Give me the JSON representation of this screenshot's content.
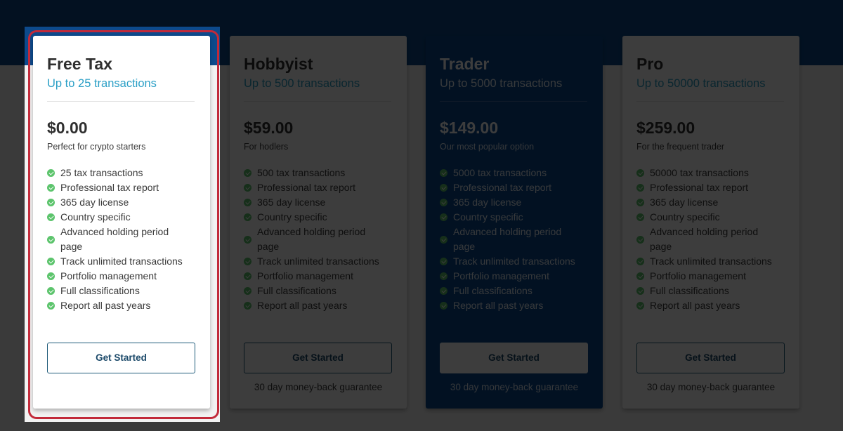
{
  "colors": {
    "brand_blue": "#0d4a8c",
    "accent_teal": "#2a9fc6",
    "check_green": "#5cc46c",
    "highlight_ring": "#c22a3a"
  },
  "plans": [
    {
      "name": "Free Tax",
      "limit": "Up to 25 transactions",
      "price": "$0.00",
      "tagline": "Perfect for crypto starters",
      "features": [
        "25 tax transactions",
        "Professional tax report",
        "365 day license",
        "Country specific",
        "Advanced holding period page",
        "Track unlimited transactions",
        "Portfolio management",
        "Full classifications",
        "Report all past years"
      ],
      "cta": "Get Started",
      "guarantee": "",
      "highlighted": true
    },
    {
      "name": "Hobbyist",
      "limit": "Up to 500 transactions",
      "price": "$59.00",
      "tagline": "For hodlers",
      "features": [
        "500 tax transactions",
        "Professional tax report",
        "365 day license",
        "Country specific",
        "Advanced holding period page",
        "Track unlimited transactions",
        "Portfolio management",
        "Full classifications",
        "Report all past years"
      ],
      "cta": "Get Started",
      "guarantee": "30 day money-back guarantee",
      "highlighted": false
    },
    {
      "name": "Trader",
      "limit": "Up to 5000 transactions",
      "price": "$149.00",
      "tagline": "Our most popular option",
      "features": [
        "5000 tax transactions",
        "Professional tax report",
        "365 day license",
        "Country specific",
        "Advanced holding period page",
        "Track unlimited transactions",
        "Portfolio management",
        "Full classifications",
        "Report all past years"
      ],
      "cta": "Get Started",
      "guarantee": "30 day money-back guarantee",
      "highlighted": false
    },
    {
      "name": "Pro",
      "limit": "Up to 50000 transactions",
      "price": "$259.00",
      "tagline": "For the frequent trader",
      "features": [
        "50000 tax transactions",
        "Professional tax report",
        "365 day license",
        "Country specific",
        "Advanced holding period page",
        "Track unlimited transactions",
        "Portfolio management",
        "Full classifications",
        "Report all past years"
      ],
      "cta": "Get Started",
      "guarantee": "30 day money-back guarantee",
      "highlighted": false
    }
  ]
}
